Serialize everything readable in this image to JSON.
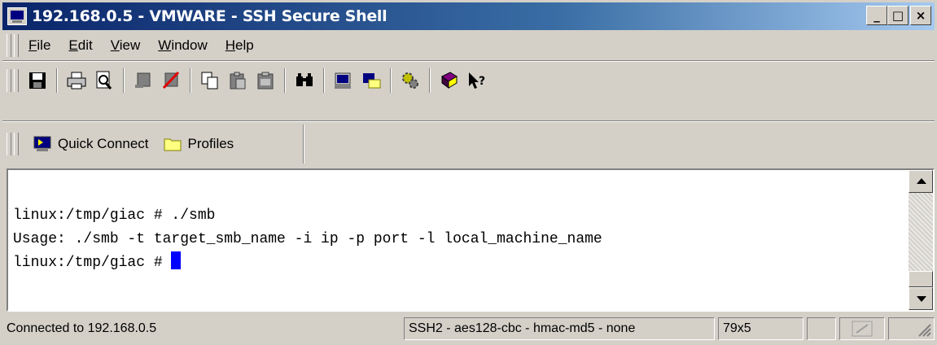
{
  "window": {
    "title": "192.168.0.5 - VMWARE - SSH Secure Shell"
  },
  "title_buttons": {
    "minimize": "_",
    "maximize": "□",
    "close": "×"
  },
  "menu": {
    "items": [
      {
        "label": "File"
      },
      {
        "label": "Edit"
      },
      {
        "label": "View"
      },
      {
        "label": "Window"
      },
      {
        "label": "Help"
      }
    ]
  },
  "toolbar": {
    "icons": [
      "save-icon",
      "print-icon",
      "print-preview-icon",
      "connect-icon",
      "disconnect-icon",
      "copy-icon",
      "paste-icon",
      "paste-alt-icon",
      "find-icon",
      "new-terminal-icon",
      "new-file-transfer-icon",
      "settings-icon",
      "help-book-icon",
      "context-help-icon"
    ]
  },
  "quick_connect": {
    "label": "Quick Connect"
  },
  "profiles": {
    "label": "Profiles"
  },
  "terminal": {
    "lines": [
      "linux:/tmp/giac # ./smb",
      "Usage: ./smb -t target_smb_name -i ip -p port -l local_machine_name",
      "linux:/tmp/giac # "
    ],
    "cursor_color": "#0000ff"
  },
  "status": {
    "connection": "Connected to 192.168.0.5",
    "cipher": "SSH2 - aes128-cbc - hmac-md5 - none",
    "size": "79x5"
  },
  "colors": {
    "title_start": "#0a246a",
    "title_end": "#a6caf0",
    "chrome": "#d4d0c8"
  }
}
